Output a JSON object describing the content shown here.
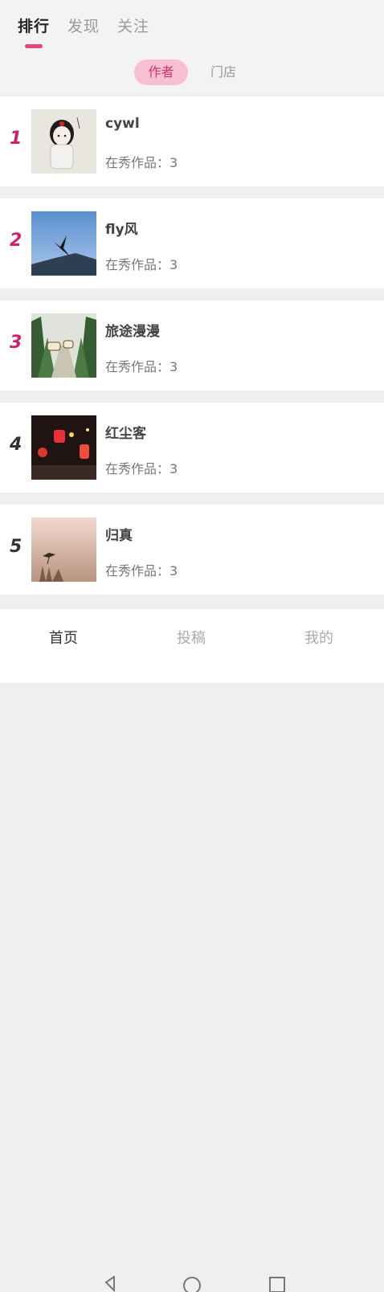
{
  "header": {
    "tabs": [
      {
        "label": "排行",
        "active": true
      },
      {
        "label": "发现",
        "active": false
      },
      {
        "label": "关注",
        "active": false
      }
    ],
    "subtabs": [
      {
        "label": "作者",
        "active": true
      },
      {
        "label": "门店",
        "active": false
      }
    ]
  },
  "authors": [
    {
      "rank": "1",
      "name": "cywl",
      "works": "在秀作品：3",
      "avatar": "girl-portrait-avatar"
    },
    {
      "rank": "2",
      "name": "fly风",
      "works": "在秀作品：3",
      "avatar": "bird-sky-avatar"
    },
    {
      "rank": "3",
      "name": "旅途漫漫",
      "works": "在秀作品：3",
      "avatar": "forest-road-avatar"
    },
    {
      "rank": "4",
      "name": "红尘客",
      "works": "在秀作品：3",
      "avatar": "lanterns-night-avatar"
    },
    {
      "rank": "5",
      "name": "归真",
      "works": "在秀作品：3",
      "avatar": "heron-mist-avatar"
    }
  ],
  "bottom_nav": {
    "items": [
      {
        "label": "首页",
        "active": true
      },
      {
        "label": "投稿",
        "active": false
      },
      {
        "label": "我的",
        "active": false
      }
    ]
  },
  "colors": {
    "accent": "#e0457f",
    "rank_top": "#c8246a",
    "pill_bg": "#f6bfd4"
  }
}
